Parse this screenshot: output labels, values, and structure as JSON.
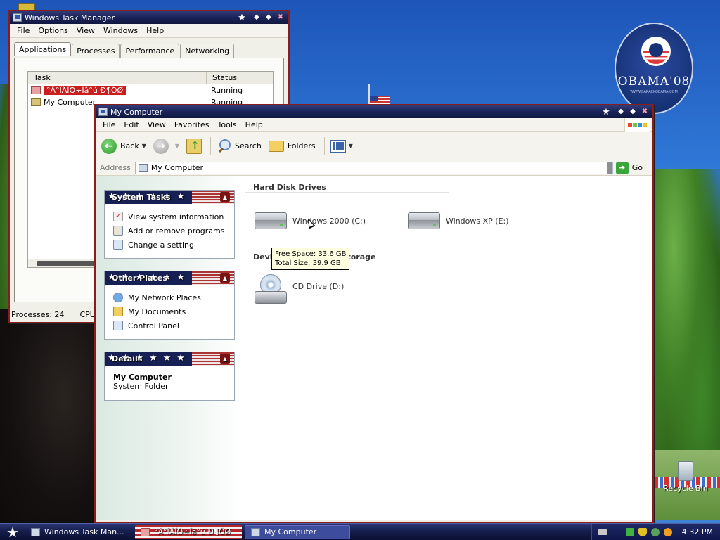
{
  "desktop": {
    "badge_text": "OBAMA'08",
    "badge_subtext": "WWW.BARACKOBAMA.COM",
    "recycle_bin_label": "Recycle Bin"
  },
  "task_manager": {
    "title": "Windows Task Manager",
    "menu": [
      "File",
      "Options",
      "View",
      "Windows",
      "Help"
    ],
    "tabs": [
      "Applications",
      "Processes",
      "Performance",
      "Networking"
    ],
    "active_tab": "Applications",
    "columns": {
      "task": "Task",
      "status": "Status"
    },
    "rows": [
      {
        "task": "°Â°ÎÂÎÓ÷Îâ°ú  Ð¶ÔØ",
        "status": "Running",
        "selected": true
      },
      {
        "task": "My Computer",
        "status": "Running",
        "selected": false
      }
    ],
    "status_processes": "Processes: 24",
    "status_cpu": "CPU"
  },
  "my_computer": {
    "title": "My Computer",
    "menu": [
      "File",
      "Edit",
      "View",
      "Favorites",
      "Tools",
      "Help"
    ],
    "toolbar": {
      "back": "Back",
      "search": "Search",
      "folders": "Folders"
    },
    "address": {
      "label": "Address",
      "value": "My Computer",
      "go": "Go"
    },
    "system_tasks": {
      "title": "System Tasks",
      "items": [
        "View system information",
        "Add or remove programs",
        "Change a setting"
      ]
    },
    "other_places": {
      "title": "Other Places",
      "items": [
        "My Network Places",
        "My Documents",
        "Control Panel"
      ]
    },
    "details": {
      "title": "Details",
      "name": "My Computer",
      "type": "System Folder"
    },
    "sections": {
      "hard_disk": "Hard Disk Drives",
      "removable": "Devices with Removable Storage",
      "removable_visible_start": "Devi",
      "removable_visible_end": "Storage"
    },
    "drives": {
      "c": "Windows 2000 (C:)",
      "e": "Windows XP (E:)",
      "d": "CD Drive (D:)"
    },
    "tooltip": {
      "free": "Free Space: 33.6 GB",
      "total": "Total Size: 39.9 GB"
    }
  },
  "taskbar": {
    "buttons": [
      "Windows Task Man...",
      "°Â°ÎÂÎÓ÷Îâ°ú  Ð¶ÔØ",
      "My Computer"
    ],
    "clock": "4:32 PM"
  },
  "colors": {
    "title_blue": "#1a2358",
    "window_border_red": "#8b1c1c",
    "selection_red": "#c81e1e",
    "tooltip_bg": "#ffffe1"
  }
}
